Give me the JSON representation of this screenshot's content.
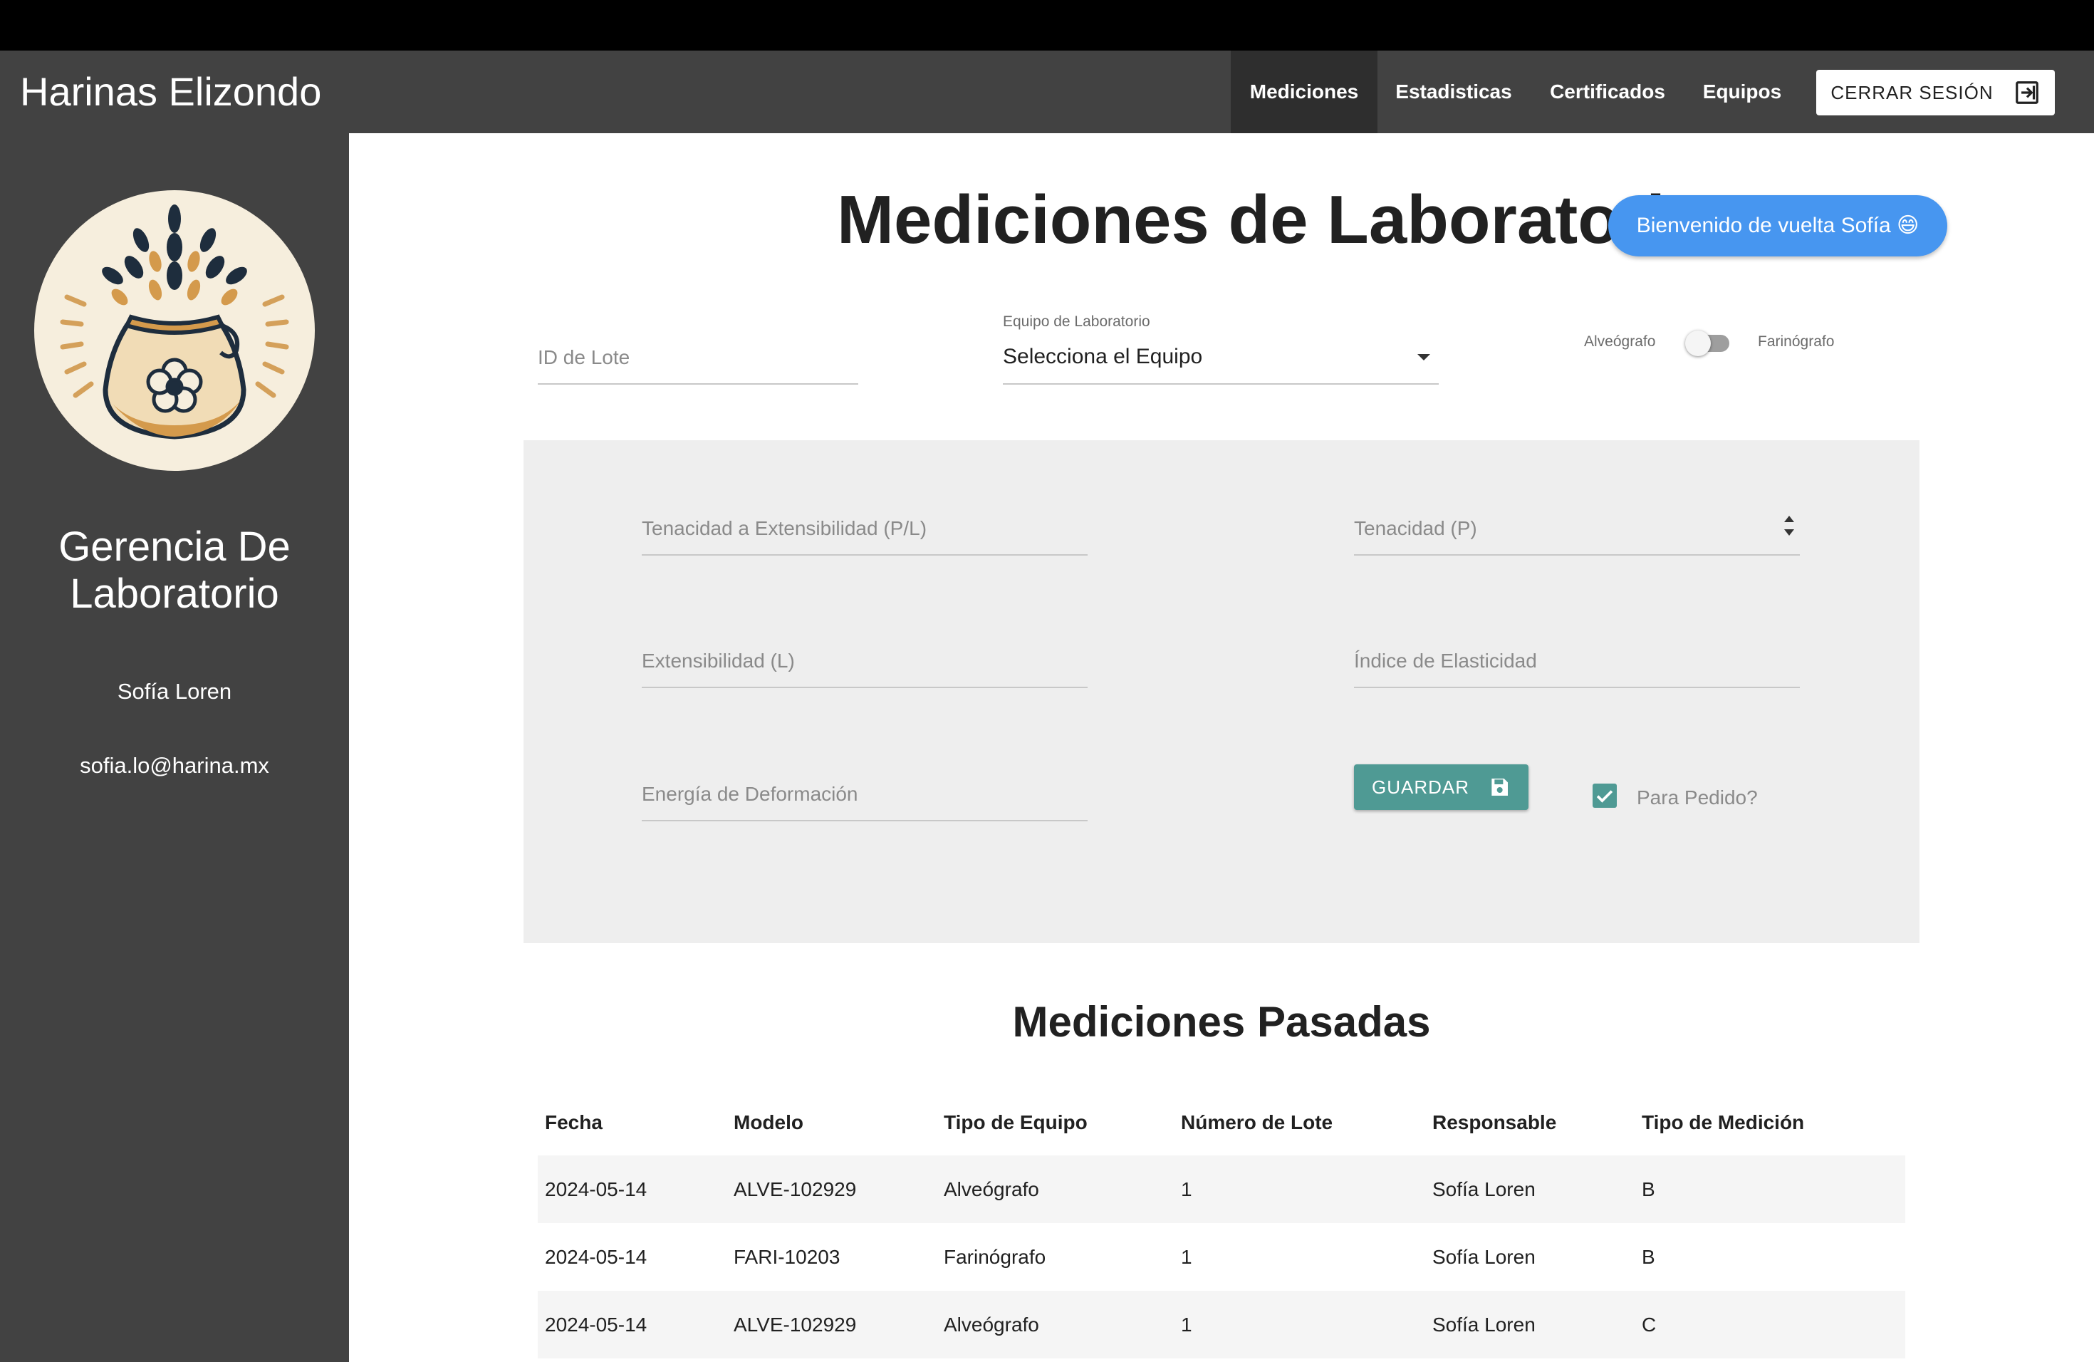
{
  "app": {
    "brand": "Harinas Elizondo",
    "nav": [
      {
        "label": "Mediciones",
        "active": true
      },
      {
        "label": "Estadisticas",
        "active": false
      },
      {
        "label": "Certificados",
        "active": false
      },
      {
        "label": "Equipos",
        "active": false
      }
    ],
    "logout_label": "CERRAR SESIÓN"
  },
  "sidebar": {
    "logo_icon": "flour-sack-wheat-logo",
    "department": "Gerencia De Laboratorio",
    "user_name": "Sofía Loren",
    "user_email": "sofia.lo@harina.mx"
  },
  "page": {
    "title": "Mediciones de Laboratorio",
    "welcome": "Bienvenido de vuelta Sofía 😄"
  },
  "form": {
    "lote_placeholder": "ID de Lote",
    "equipo_label": "Equipo de Laboratorio",
    "equipo_value": "Selecciona el Equipo",
    "switch_left": "Alveógrafo",
    "switch_right": "Farinógrafo",
    "switch_on": false,
    "fields": {
      "pl": "Tenacidad a Extensibilidad (P/L)",
      "p": "Tenacidad (P)",
      "l": "Extensibilidad (L)",
      "ie": "Índice de Elasticidad",
      "w": "Energía de Deformación"
    },
    "save_label": "GUARDAR",
    "para_pedido_label": "Para Pedido?",
    "para_pedido_checked": true
  },
  "history": {
    "title": "Mediciones Pasadas",
    "columns": [
      "Fecha",
      "Modelo",
      "Tipo de Equipo",
      "Número de Lote",
      "Responsable",
      "Tipo de Medición"
    ],
    "rows": [
      [
        "2024-05-14",
        "ALVE-102929",
        "Alveógrafo",
        "1",
        "Sofía Loren",
        "B"
      ],
      [
        "2024-05-14",
        "FARI-10203",
        "Farinógrafo",
        "1",
        "Sofía Loren",
        "B"
      ],
      [
        "2024-05-14",
        "ALVE-102929",
        "Alveógrafo",
        "1",
        "Sofía Loren",
        "C"
      ]
    ]
  },
  "colors": {
    "navbar": "#424242",
    "accent_teal": "#4f9a94",
    "welcome_blue": "#4796f0",
    "panel_bg": "#eeeeee"
  }
}
